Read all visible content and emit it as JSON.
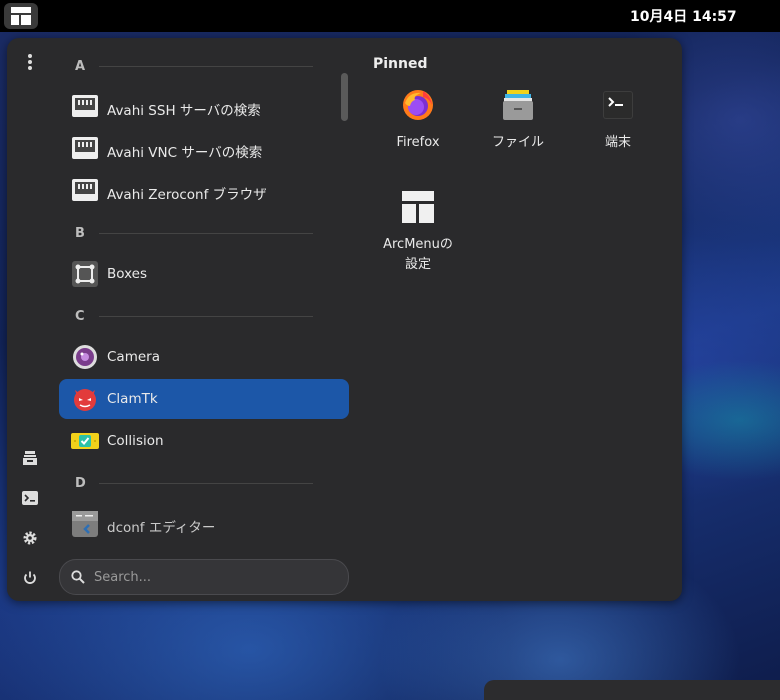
{
  "topbar": {
    "clock": "10月4日  14:57"
  },
  "sections": [
    {
      "letter": "A"
    },
    {
      "letter": "B"
    },
    {
      "letter": "C"
    },
    {
      "letter": "D"
    }
  ],
  "apps": [
    {
      "label": "Avahi SSH サーバの検索",
      "icon": "network-icon"
    },
    {
      "label": "Avahi VNC サーバの検索",
      "icon": "network-icon"
    },
    {
      "label": "Avahi Zeroconf ブラウザ",
      "icon": "network-icon"
    },
    {
      "label": "Boxes",
      "icon": "boxes-icon"
    },
    {
      "label": "Camera",
      "icon": "camera-icon"
    },
    {
      "label": "ClamTk",
      "icon": "clamtk-icon",
      "selected": true
    },
    {
      "label": "Collision",
      "icon": "collision-icon"
    },
    {
      "label": "dconf エディター",
      "icon": "dconf-icon"
    }
  ],
  "search": {
    "placeholder": "Search..."
  },
  "pinned": {
    "title": "Pinned",
    "items": [
      {
        "label": "Firefox",
        "icon": "firefox-icon"
      },
      {
        "label": "ファイル",
        "icon": "files-icon"
      },
      {
        "label": "端末",
        "icon": "terminal-icon"
      },
      {
        "label": "ArcMenuの\n設定",
        "line1": "ArcMenuの",
        "line2": "設定",
        "icon": "arcmenu-icon"
      }
    ]
  },
  "rail": [
    "more-options-icon",
    "files-icon",
    "terminal-icon",
    "settings-icon",
    "power-icon"
  ],
  "colors": {
    "selected": "#1c57a8",
    "menu_bg": "#2a2a2c"
  }
}
